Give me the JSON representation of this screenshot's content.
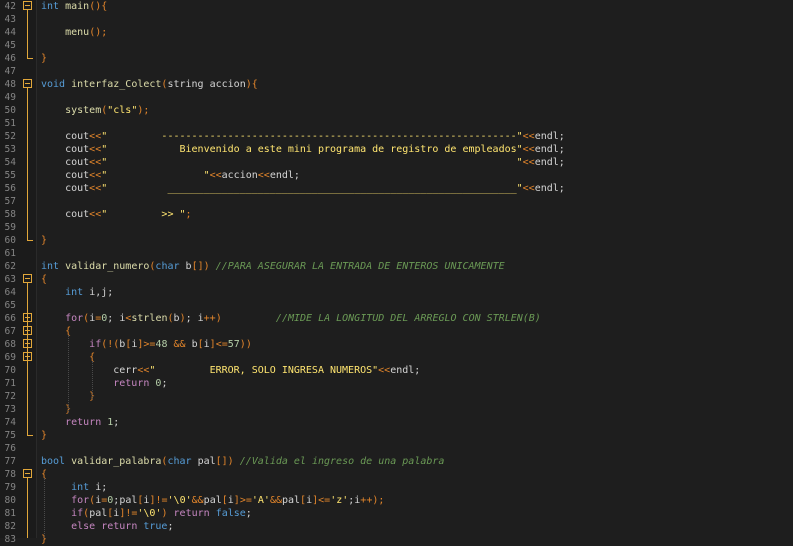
{
  "editor": {
    "lines": [
      {
        "n": "42",
        "fold": true,
        "segs": [
          [
            "ty",
            "int "
          ],
          [
            "fn",
            "main"
          ],
          [
            "pu",
            "(){"
          ]
        ]
      },
      {
        "n": "43",
        "segs": []
      },
      {
        "n": "44",
        "segs": [
          [
            "id",
            "    "
          ],
          [
            "fn",
            "menu"
          ],
          [
            "pu",
            "();"
          ]
        ]
      },
      {
        "n": "45",
        "segs": []
      },
      {
        "n": "46",
        "segs": [
          [
            "pu",
            "}"
          ]
        ]
      },
      {
        "n": "47",
        "segs": []
      },
      {
        "n": "48",
        "fold": true,
        "segs": [
          [
            "ty",
            "void "
          ],
          [
            "fn",
            "interfaz_Colect"
          ],
          [
            "pu",
            "("
          ],
          [
            "id",
            "string accion"
          ],
          [
            "pu",
            "){"
          ]
        ]
      },
      {
        "n": "49",
        "segs": []
      },
      {
        "n": "50",
        "segs": [
          [
            "id",
            "    "
          ],
          [
            "fn",
            "system"
          ],
          [
            "pu",
            "("
          ],
          [
            "st",
            "\"cls\""
          ],
          [
            "pu",
            ");"
          ]
        ]
      },
      {
        "n": "51",
        "segs": []
      },
      {
        "n": "52",
        "segs": [
          [
            "id",
            "    cout"
          ],
          [
            "op",
            "<<"
          ],
          [
            "st",
            "\"         -----------------------------------------------------------\""
          ],
          [
            "op",
            "<<"
          ],
          [
            "id",
            "endl;"
          ]
        ]
      },
      {
        "n": "53",
        "segs": [
          [
            "id",
            "    cout"
          ],
          [
            "op",
            "<<"
          ],
          [
            "st",
            "\"            Bienvenido a este mini programa de registro de empleados\""
          ],
          [
            "op",
            "<<"
          ],
          [
            "id",
            "endl;"
          ]
        ]
      },
      {
        "n": "54",
        "segs": [
          [
            "id",
            "    cout"
          ],
          [
            "op",
            "<<"
          ],
          [
            "st",
            "\"                                                                    \""
          ],
          [
            "op",
            "<<"
          ],
          [
            "id",
            "endl;"
          ]
        ]
      },
      {
        "n": "55",
        "segs": [
          [
            "id",
            "    cout"
          ],
          [
            "op",
            "<<"
          ],
          [
            "st",
            "\"                \""
          ],
          [
            "op",
            "<<"
          ],
          [
            "id",
            "accion"
          ],
          [
            "op",
            "<<"
          ],
          [
            "id",
            "endl;"
          ]
        ]
      },
      {
        "n": "56",
        "segs": [
          [
            "id",
            "    cout"
          ],
          [
            "op",
            "<<"
          ],
          [
            "st",
            "\"          __________________________________________________________\""
          ],
          [
            "op",
            "<<"
          ],
          [
            "id",
            "endl;"
          ]
        ]
      },
      {
        "n": "57",
        "segs": []
      },
      {
        "n": "58",
        "segs": [
          [
            "id",
            "    cout"
          ],
          [
            "op",
            "<<"
          ],
          [
            "st",
            "\"         >> \""
          ],
          [
            "pu",
            ";"
          ]
        ]
      },
      {
        "n": "59",
        "segs": []
      },
      {
        "n": "60",
        "segs": [
          [
            "pu",
            "}"
          ]
        ]
      },
      {
        "n": "61",
        "segs": []
      },
      {
        "n": "62",
        "segs": [
          [
            "ty",
            "int "
          ],
          [
            "fn",
            "validar_numero"
          ],
          [
            "pu",
            "("
          ],
          [
            "ty",
            "char "
          ],
          [
            "id",
            "b"
          ],
          [
            "pu",
            "[]) "
          ],
          [
            "cm",
            "//PARA ASEGURAR LA ENTRADA DE ENTEROS UNICAMENTE"
          ]
        ]
      },
      {
        "n": "63",
        "fold": true,
        "segs": [
          [
            "pu",
            "{"
          ]
        ]
      },
      {
        "n": "64",
        "segs": [
          [
            "id",
            "    "
          ],
          [
            "ty",
            "int "
          ],
          [
            "id",
            "i,j;"
          ]
        ]
      },
      {
        "n": "65",
        "segs": []
      },
      {
        "n": "66",
        "fold": true,
        "segs": [
          [
            "id",
            "    "
          ],
          [
            "kw",
            "for"
          ],
          [
            "pu",
            "("
          ],
          [
            "id",
            "i"
          ],
          [
            "op",
            "="
          ],
          [
            "nu",
            "0"
          ],
          [
            "id",
            "; i"
          ],
          [
            "op",
            "<"
          ],
          [
            "fn",
            "strlen"
          ],
          [
            "pu",
            "("
          ],
          [
            "id",
            "b"
          ],
          [
            "pu",
            ")"
          ],
          [
            "id",
            "; i"
          ],
          [
            "op",
            "++"
          ],
          [
            "pu",
            ")"
          ],
          [
            "cm",
            "         //MIDE LA LONGITUD DEL ARREGLO CON STRLEN(B)"
          ]
        ]
      },
      {
        "n": "67",
        "fold": true,
        "segs": [
          [
            "id",
            "    "
          ],
          [
            "pu",
            "{"
          ]
        ]
      },
      {
        "n": "68",
        "fold": true,
        "segs": [
          [
            "id",
            "        "
          ],
          [
            "kw",
            "if"
          ],
          [
            "pu",
            "(!("
          ],
          [
            "id",
            "b"
          ],
          [
            "pu",
            "["
          ],
          [
            "id",
            "i"
          ],
          [
            "pu",
            "]"
          ],
          [
            "op",
            ">="
          ],
          [
            "nu",
            "48 "
          ],
          [
            "op",
            "&& "
          ],
          [
            "id",
            "b"
          ],
          [
            "pu",
            "["
          ],
          [
            "id",
            "i"
          ],
          [
            "pu",
            "]"
          ],
          [
            "op",
            "<="
          ],
          [
            "nu",
            "57"
          ],
          [
            "pu",
            "))"
          ]
        ]
      },
      {
        "n": "69",
        "fold": true,
        "segs": [
          [
            "id",
            "        "
          ],
          [
            "pu",
            "{"
          ]
        ]
      },
      {
        "n": "70",
        "segs": [
          [
            "id",
            "            cerr"
          ],
          [
            "op",
            "<<"
          ],
          [
            "st",
            "\"         ERROR, SOLO INGRESA NUMEROS\""
          ],
          [
            "op",
            "<<"
          ],
          [
            "id",
            "endl;"
          ]
        ]
      },
      {
        "n": "71",
        "segs": [
          [
            "id",
            "            "
          ],
          [
            "kw",
            "return "
          ],
          [
            "nu",
            "0"
          ],
          [
            "id",
            ";"
          ]
        ]
      },
      {
        "n": "72",
        "segs": [
          [
            "id",
            "        "
          ],
          [
            "pu",
            "}"
          ]
        ]
      },
      {
        "n": "73",
        "segs": [
          [
            "id",
            "    "
          ],
          [
            "pu",
            "}"
          ]
        ]
      },
      {
        "n": "74",
        "segs": [
          [
            "id",
            "    "
          ],
          [
            "kw",
            "return "
          ],
          [
            "nu",
            "1"
          ],
          [
            "id",
            ";"
          ]
        ]
      },
      {
        "n": "75",
        "segs": [
          [
            "pu",
            "}"
          ]
        ]
      },
      {
        "n": "76",
        "segs": []
      },
      {
        "n": "77",
        "segs": [
          [
            "ty",
            "bool "
          ],
          [
            "fn",
            "validar_palabra"
          ],
          [
            "pu",
            "("
          ],
          [
            "ty",
            "char "
          ],
          [
            "id",
            "pal"
          ],
          [
            "pu",
            "[]) "
          ],
          [
            "cm",
            "//Valida el ingreso de una palabra"
          ]
        ]
      },
      {
        "n": "78",
        "fold": true,
        "segs": [
          [
            "pu",
            "{"
          ]
        ]
      },
      {
        "n": "79",
        "segs": [
          [
            "id",
            "     "
          ],
          [
            "ty",
            "int "
          ],
          [
            "id",
            "i;"
          ]
        ]
      },
      {
        "n": "80",
        "segs": [
          [
            "id",
            "     "
          ],
          [
            "kw",
            "for"
          ],
          [
            "pu",
            "("
          ],
          [
            "id",
            "i"
          ],
          [
            "op",
            "="
          ],
          [
            "nu",
            "0"
          ],
          [
            "id",
            ";pal"
          ],
          [
            "pu",
            "["
          ],
          [
            "id",
            "i"
          ],
          [
            "pu",
            "]"
          ],
          [
            "op",
            "!="
          ],
          [
            "st",
            "'\\0'"
          ],
          [
            "op",
            "&&"
          ],
          [
            "id",
            "pal"
          ],
          [
            "pu",
            "["
          ],
          [
            "id",
            "i"
          ],
          [
            "pu",
            "]"
          ],
          [
            "op",
            ">="
          ],
          [
            "st",
            "'A'"
          ],
          [
            "op",
            "&&"
          ],
          [
            "id",
            "pal"
          ],
          [
            "pu",
            "["
          ],
          [
            "id",
            "i"
          ],
          [
            "pu",
            "]"
          ],
          [
            "op",
            "<="
          ],
          [
            "st",
            "'z'"
          ],
          [
            "id",
            ";i"
          ],
          [
            "op",
            "++"
          ],
          [
            "pu",
            ");"
          ]
        ]
      },
      {
        "n": "81",
        "segs": [
          [
            "id",
            "     "
          ],
          [
            "kw",
            "if"
          ],
          [
            "pu",
            "("
          ],
          [
            "id",
            "pal"
          ],
          [
            "pu",
            "["
          ],
          [
            "id",
            "i"
          ],
          [
            "pu",
            "]"
          ],
          [
            "op",
            "!="
          ],
          [
            "st",
            "'\\0'"
          ],
          [
            "pu",
            ") "
          ],
          [
            "kw",
            "return "
          ],
          [
            "ty",
            "false"
          ],
          [
            "id",
            ";"
          ]
        ]
      },
      {
        "n": "82",
        "segs": [
          [
            "id",
            "     "
          ],
          [
            "kw",
            "else return "
          ],
          [
            "ty",
            "true"
          ],
          [
            "id",
            ";"
          ]
        ]
      },
      {
        "n": "83",
        "segs": [
          [
            "pu",
            "}"
          ]
        ]
      }
    ]
  }
}
